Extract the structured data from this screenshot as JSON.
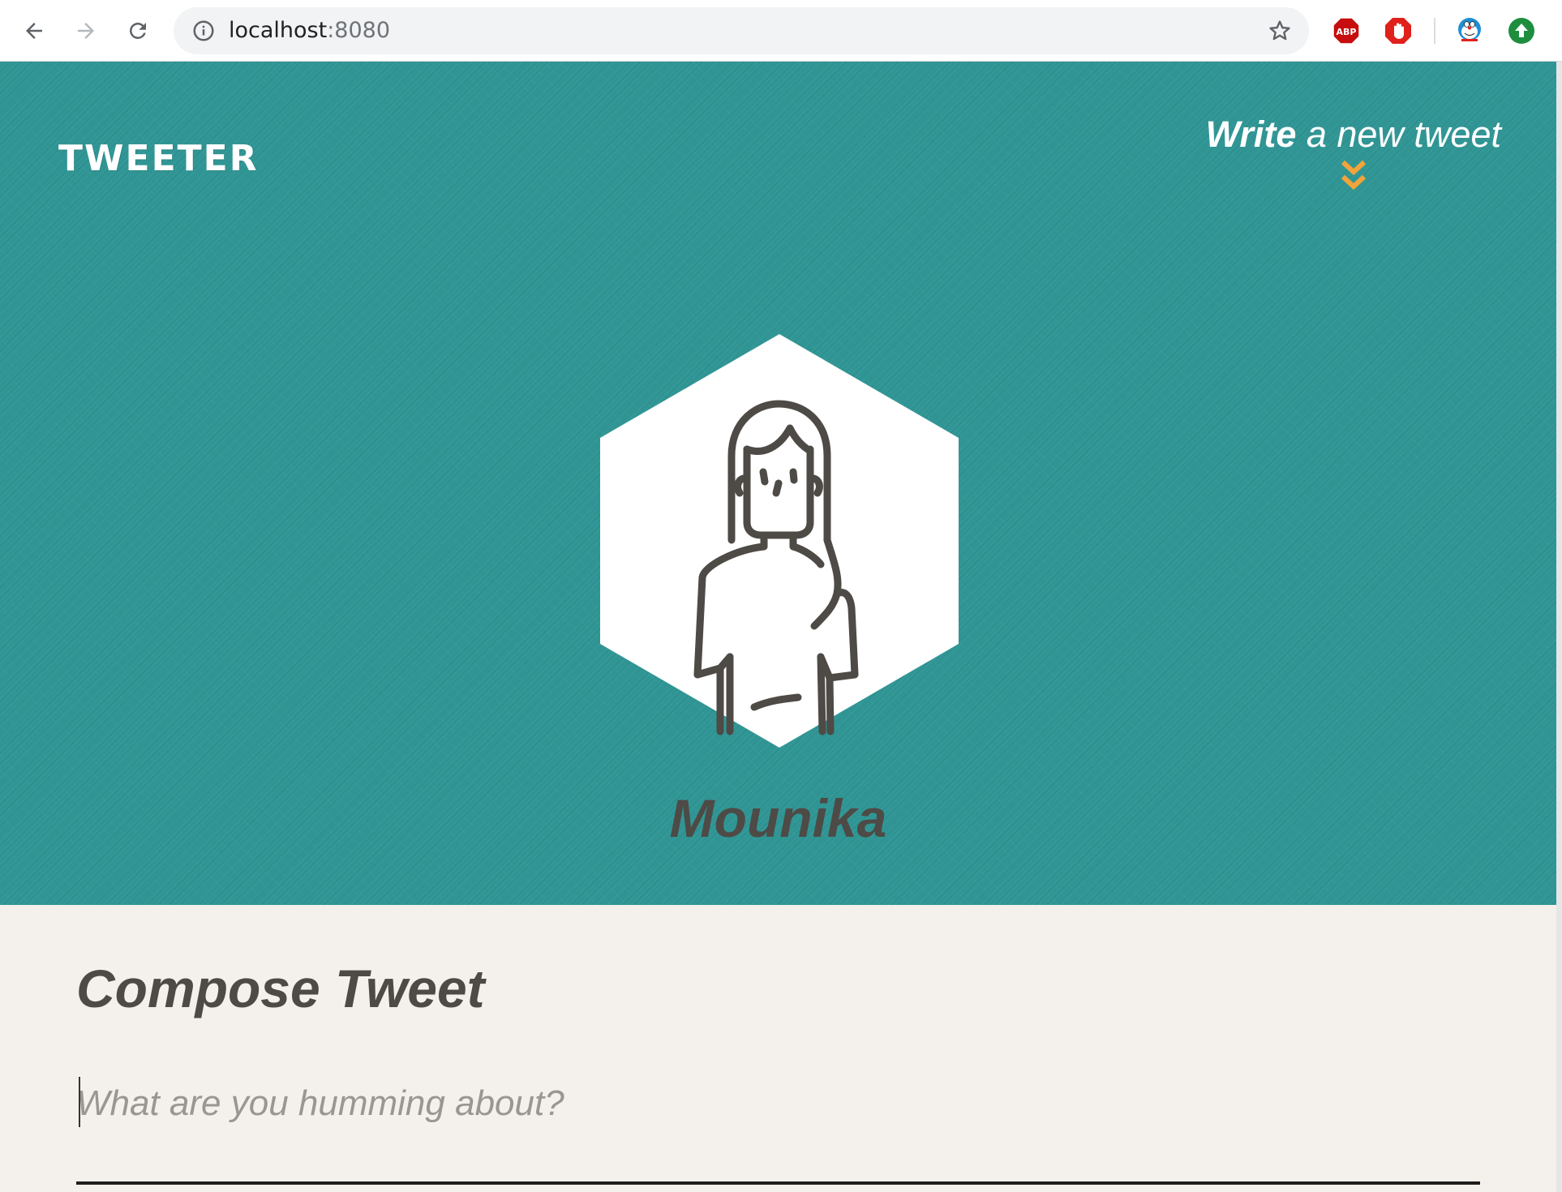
{
  "browser": {
    "url_host": "localhost",
    "url_port": ":8080",
    "extensions": [
      {
        "name": "adblock-plus",
        "label": "ABP",
        "color": "#c70d0d"
      },
      {
        "name": "adblock",
        "color": "#e0201b"
      },
      {
        "name": "doraemon",
        "color": "#1e8fd6"
      },
      {
        "name": "upload",
        "color": "#1e8e3e"
      }
    ]
  },
  "header": {
    "brand": "TWEETER",
    "write_strong": "Write",
    "write_rest": " a new tweet",
    "accent_color": "#f2a43a",
    "hero_color": "#2f9594"
  },
  "profile": {
    "name": "Mounika",
    "avatar_icon": "woman-avatar-icon"
  },
  "compose": {
    "title": "Compose Tweet",
    "placeholder": "What are you humming about?",
    "value": ""
  }
}
